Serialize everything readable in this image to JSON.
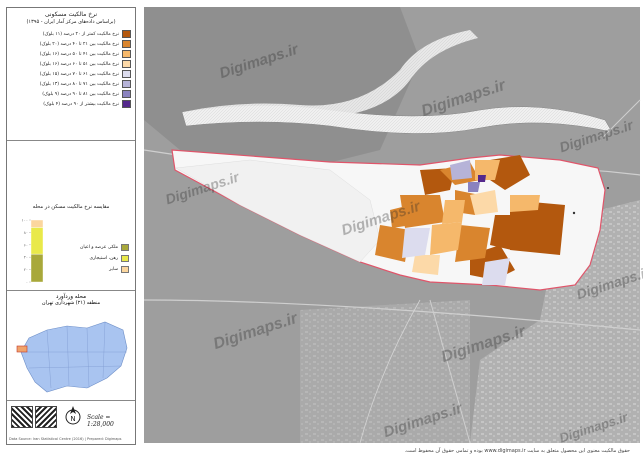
{
  "legend": {
    "title": "نرخ مالکیت مسکونی",
    "subtitle": "(براساس داده‌های مرکز آمار ایران - ۱۳۹۵)",
    "items": [
      {
        "label": "نرخ مالکیت کمتر از ۲۰ درصد (۱۱ بلوک)",
        "color": "#b3580e"
      },
      {
        "label": "نرخ مالکیت بین ۲۱ تا ۴۰ درصد (۲۰ بلوک)",
        "color": "#d9852e"
      },
      {
        "label": "نرخ مالکیت بین ۴۱ تا ۵۰ درصد (۱۶ بلوک)",
        "color": "#f5b86b"
      },
      {
        "label": "نرخ مالکیت بین ۵۱ تا ۶۰ درصد (۱۶ بلوک)",
        "color": "#fcd9a8"
      },
      {
        "label": "نرخ مالکیت بین ۶۱ تا ۷۰ درصد (۱۵ بلوک)",
        "color": "#dcdcee"
      },
      {
        "label": "نرخ مالکیت بین ۷۱ تا ۸۰ درصد (۱۳ بلوک)",
        "color": "#b6b3d8"
      },
      {
        "label": "نرخ مالکیت بین ۸۱ تا ۹۰ درصد (۹ بلوک)",
        "color": "#8a82bf"
      },
      {
        "label": "نرخ مالکیت بیشتر از ۹۰ درصد (۴ بلوک)",
        "color": "#54288c"
      }
    ]
  },
  "chart": {
    "title": "مقایسه نرخ مالکیت مسکن در محله",
    "ticks": [
      "۱۰۰",
      "۸۰",
      "۶۰",
      "۴۰",
      "۲۰",
      "۰"
    ],
    "keys": [
      {
        "label": "ملکی عرصه و اعیان",
        "color": "#a8a83a"
      },
      {
        "label": "رهن، استیجاری",
        "color": "#e9e94a"
      },
      {
        "label": "سایر",
        "color": "#fbd69e"
      }
    ]
  },
  "chart_data": {
    "type": "bar",
    "categories": [
      ""
    ],
    "series": [
      {
        "name": "ملکی عرصه و اعیان",
        "values": [
          45
        ]
      },
      {
        "name": "رهن، استیجاری",
        "values": [
          43
        ]
      },
      {
        "name": "سایر",
        "values": [
          12
        ]
      }
    ],
    "stacked": true,
    "ylim": [
      0,
      100
    ],
    "colors": [
      "#a8a83a",
      "#e9e94a",
      "#fbd69e"
    ]
  },
  "locator": {
    "title": "محله وردآورد",
    "subtitle": "منطقه (۲۱) شهرداری تهران"
  },
  "scale_text": "Scale = 1:28,000",
  "credit_small": "Data Source: Iran Statistical Centre (2016) | Prepared: Digimaps",
  "watermark": "Digimaps.ir",
  "copyright": "حقوق مالکیت معنوی این محصول متعلق به سایت www.digimaps.ir بوده و تمامی حقوق آن محفوظ است."
}
